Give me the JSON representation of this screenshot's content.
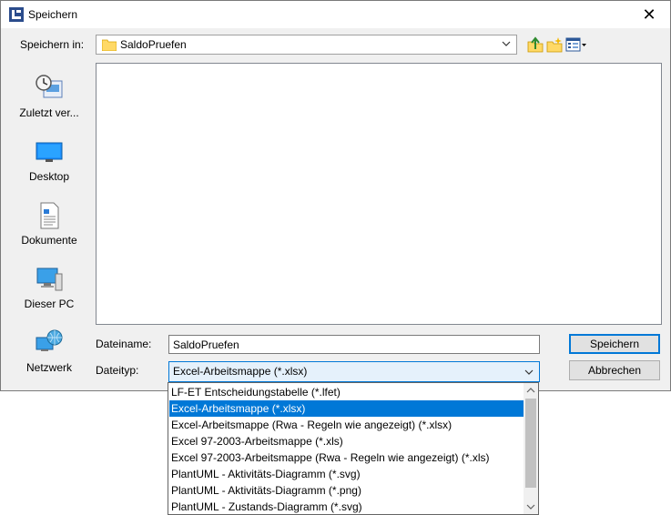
{
  "window": {
    "title": "Speichern"
  },
  "toolbar": {
    "save_in_label": "Speichern in:",
    "folder": "SaldoPruefen"
  },
  "places": [
    {
      "label": "Zuletzt ver...",
      "icon": "recent-places-icon"
    },
    {
      "label": "Desktop",
      "icon": "desktop-icon"
    },
    {
      "label": "Dokumente",
      "icon": "documents-icon"
    },
    {
      "label": "Dieser PC",
      "icon": "computer-icon"
    },
    {
      "label": "Netzwerk",
      "icon": "network-icon"
    }
  ],
  "form": {
    "filename_label": "Dateiname:",
    "filename_value": "SaldoPruefen",
    "filetype_label": "Dateityp:",
    "filetype_value": "Excel-Arbeitsmappe (*.xlsx)"
  },
  "buttons": {
    "save": "Speichern",
    "cancel": "Abbrechen"
  },
  "filetype_options": [
    "LF-ET Entscheidungstabelle (*.lfet)",
    "Excel-Arbeitsmappe (*.xlsx)",
    "Excel-Arbeitsmappe (Rwa - Regeln wie angezeigt) (*.xlsx)",
    "Excel 97-2003-Arbeitsmappe (*.xls)",
    "Excel 97-2003-Arbeitsmappe (Rwa - Regeln wie angezeigt) (*.xls)",
    "PlantUML - Aktivitäts-Diagramm (*.svg)",
    "PlantUML - Aktivitäts-Diagramm (*.png)",
    "PlantUML - Zustands-Diagramm (*.svg)"
  ],
  "selected_option_index": 1,
  "colors": {
    "accent": "#0078d7",
    "dialog_bg": "#f0f0f0",
    "folder": "#ffd966"
  }
}
